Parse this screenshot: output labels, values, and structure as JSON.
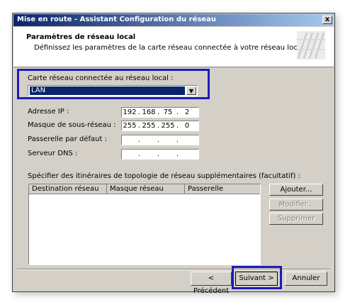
{
  "window": {
    "title": "Mise en route - Assistant Configuration du réseau",
    "close_glyph": "x"
  },
  "header": {
    "title": "Paramètres de réseau local",
    "subtitle": "Définissez les paramètres de la carte réseau connectée à votre réseau local."
  },
  "adapter": {
    "label": "Carte réseau connectée au réseau local :",
    "selected": "LAN"
  },
  "fields": {
    "ip": {
      "label": "Adresse IP :",
      "octets": [
        "192",
        "168",
        "75",
        "2"
      ]
    },
    "mask": {
      "label": "Masque de sous-réseau :",
      "octets": [
        "255",
        "255",
        "255",
        "0"
      ]
    },
    "gateway": {
      "label": "Passerelle par défaut :",
      "octets": [
        "",
        "",
        "",
        ""
      ]
    },
    "dns": {
      "label": "Serveur DNS :",
      "octets": [
        "",
        "",
        "",
        ""
      ]
    }
  },
  "routes": {
    "label": "Spécifier des itinéraires de topologie de réseau supplémentaires (facultatif) :",
    "columns": [
      "Destination réseau",
      "Masque réseau",
      "Passerelle"
    ],
    "rows": []
  },
  "route_buttons": {
    "add": "Ajouter...",
    "modify": "Modifier...",
    "delete": "Supprimer"
  },
  "footer": {
    "back": "< Précédent",
    "next": "Suivant >",
    "cancel": "Annuler"
  },
  "colors": {
    "highlight": "#1c1cb8",
    "title_bar": "#0a246a",
    "dialog_face": "#d4d0c8"
  },
  "icons": {
    "dropdown": "chevron-down-icon",
    "logo": "wizard-logo-icon"
  }
}
